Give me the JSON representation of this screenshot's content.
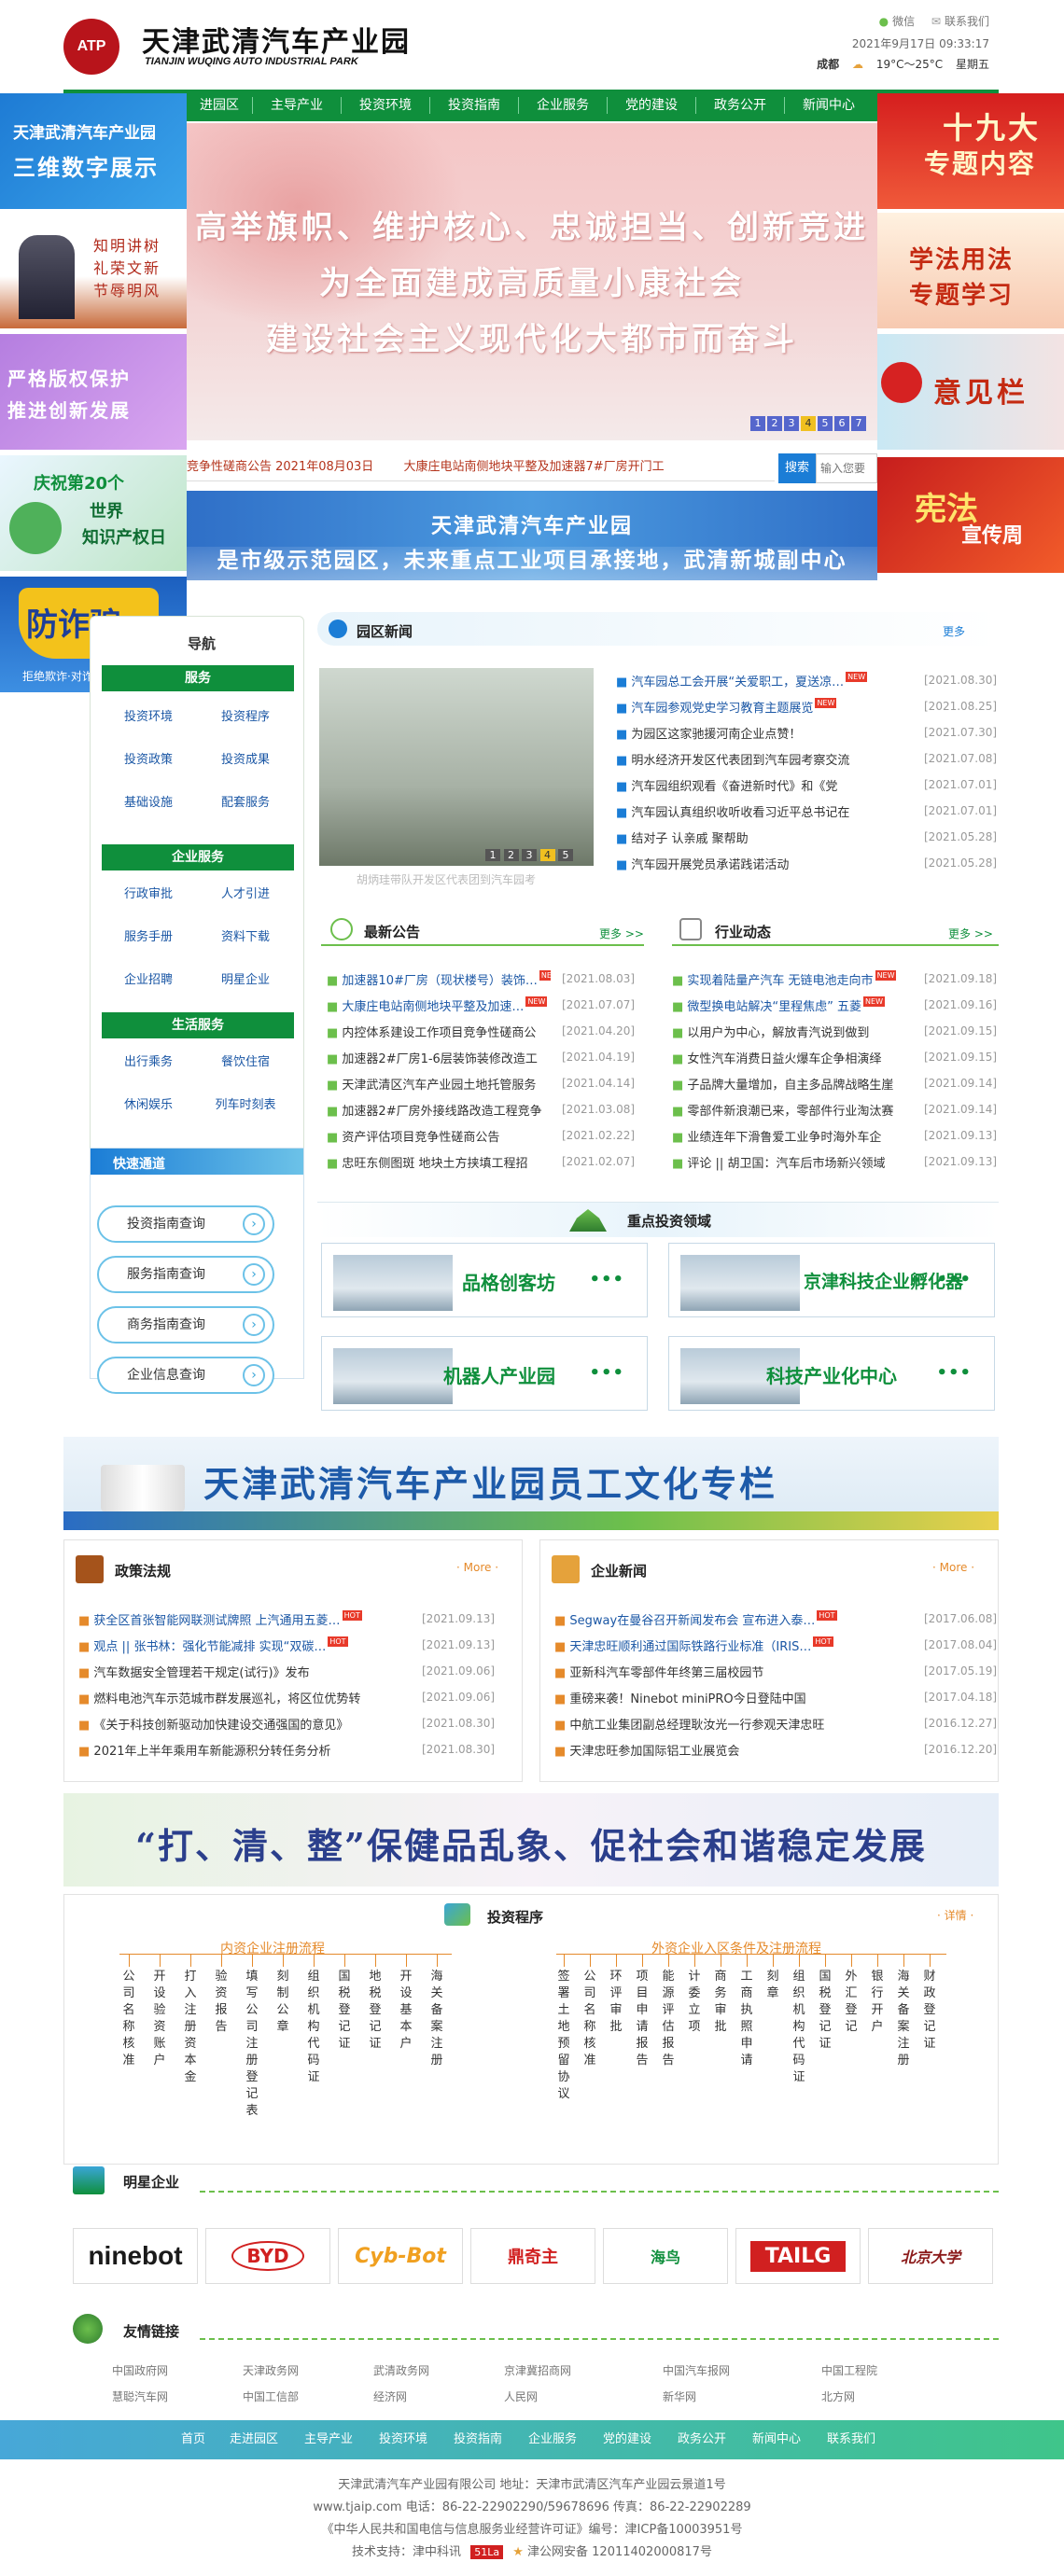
{
  "header": {
    "logo_mark": "ATP",
    "title_cn": "天津武清汽车产业园",
    "title_en": "TIANJIN WUQING AUTO INDUSTRIAL PARK",
    "links": [
      "微信",
      "联系我们"
    ],
    "datetime": "2021年9月17日 09:33:17",
    "weekday": "星期五",
    "city": "成都",
    "temp": "19°C～25°C"
  },
  "nav": [
    "进园区",
    "主导产业",
    "投资环境",
    "投资指南",
    "企业服务",
    "党的建设",
    "政务公开",
    "新闻中心"
  ],
  "banner": {
    "lines": [
      "高举旗帜、维护核心、忠诚担当、创新竞进",
      "为全面建成高质量小康社会",
      "建设社会主义现代化大都市而奋斗"
    ],
    "dots": [
      "1",
      "2",
      "3",
      "4",
      "5",
      "6",
      "7"
    ],
    "active_dot": "4"
  },
  "left_ads": {
    "ad1_l1": "天津武清汽车产业园",
    "ad1_l2": "三维数字展示",
    "ad2_l1": "知明讲树",
    "ad2_l2": "礼荣文新",
    "ad2_l3": "节辱明风",
    "ad3_l1": "严格版权保护",
    "ad3_l2": "推进创新发展",
    "ad4_l1": "庆祝第20个",
    "ad4_l2": "世界",
    "ad4_l3": "知识产权日",
    "ad5_l1": "防诈骗",
    "ad5_l2": "拒绝欺诈·对诈骗说NO"
  },
  "right_ads": {
    "ad1": "十九大专题内容",
    "ad1_a": "十九大",
    "ad1_b": "专题内容",
    "ad2_a": "学法用法",
    "ad2_b": "专题学习",
    "ad3": "意见栏",
    "ad4_a": "宪法",
    "ad4_b": "宣传周"
  },
  "ticker": {
    "items": [
      "竞争性磋商公告 2021年08月03日",
      "大康庄电站南侧地块平整及加速器7#厂房开门工"
    ],
    "search_label": "搜索",
    "search_placeholder": "输入您要"
  },
  "slogan": {
    "line1": "天津武清汽车产业园",
    "line2": "是市级示范园区，未来重点工业项目承接地，武清新城副中心"
  },
  "guide": {
    "title": "导航",
    "g1_title": "服务",
    "g1_items": [
      "投资环境",
      "投资程序",
      "投资政策",
      "投资成果",
      "基础设施",
      "配套服务"
    ],
    "g2_title": "企业服务",
    "g2_items": [
      "行政审批",
      "人才引进",
      "服务手册",
      "资料下载",
      "企业招聘",
      "明星企业"
    ],
    "g3_title": "生活服务",
    "g3_items": [
      "出行乘务",
      "餐饮住宿",
      "休闲娱乐",
      "列车时刻表"
    ]
  },
  "quick": {
    "title": "快速通道",
    "items": [
      "投资指南查询",
      "服务指南查询",
      "商务指南查询",
      "企业信息查询"
    ]
  },
  "park_news": {
    "title": "园区新闻",
    "more": "更多",
    "photo_caption": "胡炳珪带队开发区代表团到汽车园考",
    "photo_dots": [
      "1",
      "2",
      "3",
      "4",
      "5"
    ],
    "active_dot": "4",
    "items": [
      {
        "text": "汽车园总工会开展“关爱职工，夏送凉…",
        "date": "[2021.08.30]",
        "new": true
      },
      {
        "text": "汽车园参观党史学习教育主题展览",
        "date": "[2021.08.25]",
        "new": true
      },
      {
        "text": "为园区这家驰援河南企业点赞！",
        "date": "[2021.07.30]",
        "new": false
      },
      {
        "text": "明水经济开发区代表团到汽车园考察交流",
        "date": "[2021.07.08]",
        "new": false
      },
      {
        "text": "汽车园组织观看《奋进新时代》和《党",
        "date": "[2021.07.01]",
        "new": false
      },
      {
        "text": "汽车园认真组织收听收看习近平总书记在",
        "date": "[2021.07.01]",
        "new": false
      },
      {
        "text": "结对子 认亲戚 聚帮助",
        "date": "[2021.05.28]",
        "new": false
      },
      {
        "text": "汽车园开展党员承诺践诺活动",
        "date": "[2021.05.28]",
        "new": false
      }
    ]
  },
  "notices": {
    "title": "最新公告",
    "more": "更多 >>",
    "items": [
      {
        "text": "加速器10#厂房（现状楼号）装饰…",
        "date": "[2021.08.03]",
        "new": true
      },
      {
        "text": "大康庄电站南侧地块平整及加速…",
        "date": "[2021.07.07]",
        "new": true
      },
      {
        "text": "内控体系建设工作项目竞争性磋商公",
        "date": "[2021.04.20]",
        "new": false
      },
      {
        "text": "加速器2#厂房1-6层装饰装修改造工",
        "date": "[2021.04.19]",
        "new": false
      },
      {
        "text": "天津武清区汽车产业园土地托管服务",
        "date": "[2021.04.14]",
        "new": false
      },
      {
        "text": "加速器2#厂房外接线路改造工程竞争",
        "date": "[2021.03.08]",
        "new": false
      },
      {
        "text": "资产评估项目竞争性磋商公告",
        "date": "[2021.02.22]",
        "new": false
      },
      {
        "text": "忠旺东侧图斑 地块土方挟填工程招",
        "date": "[2021.02.07]",
        "new": false
      }
    ]
  },
  "industry": {
    "title": "行业动态",
    "more": "更多 >>",
    "items": [
      {
        "text": "实现着陆量产汽车 无链电池走向市",
        "date": "[2021.09.18]",
        "new": true
      },
      {
        "text": "微型换电站解决“里程焦虑” 五菱",
        "date": "[2021.09.16]",
        "new": true
      },
      {
        "text": "以用户为中心，解放青汽说到做到",
        "date": "[2021.09.15]",
        "new": false
      },
      {
        "text": "女性汽车消费日益火爆车企争相演绎",
        "date": "[2021.09.15]",
        "new": false
      },
      {
        "text": "子品牌大量增加，自主多品牌战略生崖",
        "date": "[2021.09.14]",
        "new": false
      },
      {
        "text": "零部件新浪潮已来，零部件行业淘汰赛",
        "date": "[2021.09.14]",
        "new": false
      },
      {
        "text": "业绩连年下滑鲁爱工业争时海外车企",
        "date": "[2021.09.13]",
        "new": false
      },
      {
        "text": "评论 || 胡卫国：汽车后市场新兴领域",
        "date": "[2021.09.13]",
        "new": false
      }
    ]
  },
  "invest_areas": {
    "title": "重点投资领域",
    "items": [
      "品格创客坊",
      "京津科技企业孵化器",
      "机器人产业园",
      "科技产业化中心"
    ],
    "dots": "•••"
  },
  "culture": {
    "title": "天津武清汽车产业园员工文化专栏"
  },
  "policy": {
    "title": "政策法规",
    "more": "· More ·",
    "items": [
      {
        "text": "获全区首张智能网联测试牌照 上汽通用五菱…",
        "date": "[2021.09.13]",
        "hot": true
      },
      {
        "text": "观点 || 张书林：强化节能减排 实现“双碳…",
        "date": "[2021.09.13]",
        "hot": true
      },
      {
        "text": "汽车数据安全管理若干规定(试行)》发布",
        "date": "[2021.09.06]",
        "hot": false
      },
      {
        "text": "燃料电池汽车示范城市群发展巡礼，将区位优势转",
        "date": "[2021.09.06]",
        "hot": false
      },
      {
        "text": "《关于科技创新驱动加快建设交通强国的意见》",
        "date": "[2021.08.30]",
        "hot": false
      },
      {
        "text": "2021年上半年乘用车新能源积分转任务分析",
        "date": "[2021.08.30]",
        "hot": false
      }
    ]
  },
  "corp_news": {
    "title": "企业新闻",
    "more": "· More ·",
    "items": [
      {
        "text": "Segway在曼谷召开新闻发布会 宣布进入泰…",
        "date": "[2017.06.08]",
        "hot": true
      },
      {
        "text": "天津忠旺顺利通过国际铁路行业标准（IRIS…",
        "date": "[2017.08.04]",
        "hot": true
      },
      {
        "text": "亚新科汽车零部件年终第三届校园节",
        "date": "[2017.05.19]",
        "hot": false
      },
      {
        "text": "重磅来袭！Ninebot miniPRO今日登陆中国",
        "date": "[2017.04.18]",
        "hot": false
      },
      {
        "text": "中航工业集团副总经理耿汝光一行参观天津忠旺",
        "date": "[2016.12.27]",
        "hot": false
      },
      {
        "text": "天津忠旺参加国际铝工业展览会",
        "date": "[2016.12.20]",
        "hot": false
      }
    ]
  },
  "promo": {
    "title": "“打、清、整”保健品乱象、促社会和谐稳定发展"
  },
  "process": {
    "title": "投资程序",
    "more": "· 详情 ·",
    "domestic_title": "内资企业注册流程",
    "foreign_title": "外资企业入区条件及注册流程",
    "domestic_steps": [
      "公司名称核准",
      "开设验资账户",
      "打入注册资本金",
      "验资报告",
      "填写公司注册登记表",
      "刻制公章",
      "组织机构代码证",
      "国税登记证",
      "地税登记证",
      "开设基本户",
      "海关备案注册"
    ],
    "foreign_steps": [
      "签署土地预留协议",
      "公司名称核准",
      "环评审批",
      "项目申请报告",
      "能源评估报告",
      "计委立项",
      "商务审批",
      "工商执照申请",
      "刻章",
      "组织机构代码证",
      "国税登记证",
      "外汇登记",
      "银行开户",
      "海关备案注册",
      "财政登记证"
    ]
  },
  "partners": {
    "title": "明星企业",
    "items": [
      "ninebot",
      "BYD",
      "Cyb-Bot",
      "鼎奇主",
      "海鸟",
      "TAILG",
      "北京大学"
    ]
  },
  "links": {
    "title": "友情链接",
    "row1": [
      "中国政府网",
      "天津政务网",
      "武清政务网",
      "京津冀招商网",
      "中国汽车报网",
      "中国工程院"
    ],
    "row2": [
      "慧聪汽车网",
      "中国工信部",
      "经济网",
      "人民网",
      "新华网",
      "北方网"
    ]
  },
  "footer": {
    "nav": [
      "首页",
      "走进园区",
      "主导产业",
      "投资环境",
      "投资指南",
      "企业服务",
      "党的建设",
      "政务公开",
      "新闻中心",
      "联系我们"
    ],
    "line1": "天津武清汽车产业园有限公司    地址：天津市武清区汽车产业园云景道1号",
    "line2": "www.tjaip.com    电话：86-22-22902290/59678696    传真：86-22-22902289",
    "line3": "《中华人民共和国电信与信息服务业经营许可证》编号：津ICP备10003951号",
    "line4": "技术支持：",
    "support_name": "津中科讯",
    "badge": "51La",
    "police": "津公网安备 12011402000817号"
  },
  "colors": {
    "green": "#0f8f3c",
    "blue": "#1b7dd6",
    "red": "#b8141b",
    "orange": "#e58a2b"
  }
}
